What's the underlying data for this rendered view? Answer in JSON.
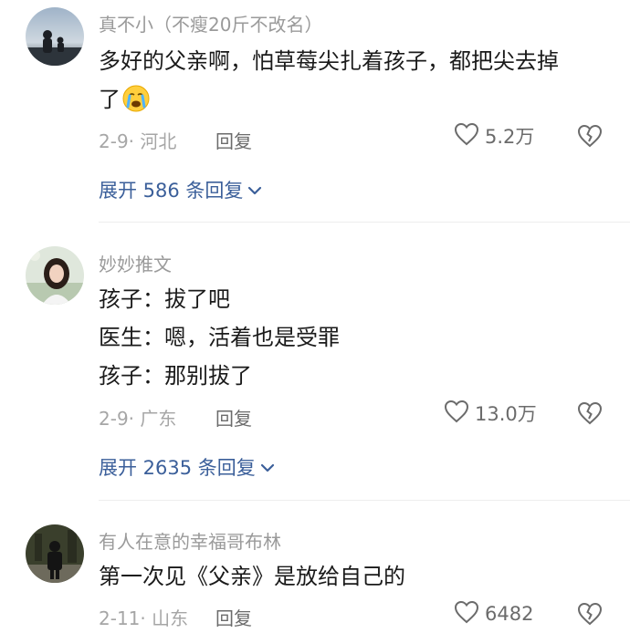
{
  "comments": [
    {
      "username": "真不小（不瘦20斤不改名）",
      "lines": [
        "多好的父亲啊，怕草莓尖扎着孩子，都把尖去掉",
        "了"
      ],
      "emoji": "crying-face-icon",
      "date_location": "2-9· 河北",
      "reply_label": "回复",
      "like_count": "5.2万",
      "expand_label": "展开 586 条回复"
    },
    {
      "username": "妙妙推文",
      "lines": [
        "孩子：拔了吧",
        "医生：嗯，活着也是受罪",
        "孩子：那别拔了"
      ],
      "date_location": "2-9· 广东",
      "reply_label": "回复",
      "like_count": "13.0万",
      "expand_label": "展开 2635 条回复"
    },
    {
      "username": "有人在意的幸福哥布林",
      "lines": [
        "第一次见《父亲》是放给自己的"
      ],
      "date_location": "2-11· 山东",
      "reply_label": "回复",
      "like_count": "6482"
    }
  ],
  "colors": {
    "link": "#3b5f9a",
    "meta": "#a6a6a6",
    "username": "#9a9a9a"
  }
}
